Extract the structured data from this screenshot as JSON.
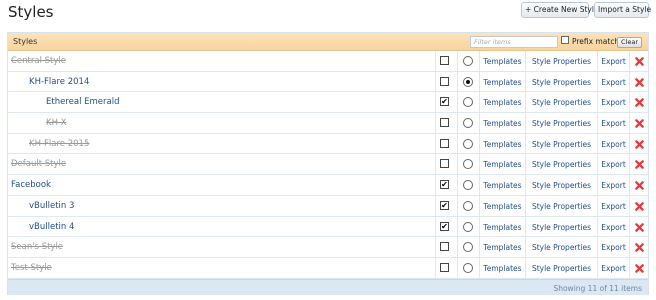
{
  "header": {
    "title": "Styles",
    "create_button": "+ Create New Style",
    "import_button": "Import a Style"
  },
  "filter": {
    "section_title": "Styles",
    "placeholder": "Filter items",
    "prefix_label": "Prefix match",
    "clear_label": "Clear"
  },
  "links": {
    "templates": "Templates",
    "properties": "Style Properties",
    "export": "Export"
  },
  "styles": [
    {
      "title": "Central Style",
      "level": 0,
      "active": false,
      "checked": false,
      "selected": false
    },
    {
      "title": "KH-Flare 2014",
      "level": 1,
      "active": true,
      "checked": false,
      "selected": true
    },
    {
      "title": "Ethereal Emerald",
      "level": 2,
      "active": true,
      "checked": true,
      "selected": false
    },
    {
      "title": "KH-X",
      "level": 2,
      "active": false,
      "checked": false,
      "selected": false
    },
    {
      "title": "KH-Flare 2015",
      "level": 1,
      "active": false,
      "checked": false,
      "selected": false
    },
    {
      "title": "Default Style",
      "level": 0,
      "active": false,
      "checked": false,
      "selected": false
    },
    {
      "title": "Facebook",
      "level": 0,
      "active": true,
      "checked": true,
      "selected": false
    },
    {
      "title": "vBulletin 3",
      "level": 1,
      "active": true,
      "checked": true,
      "selected": false
    },
    {
      "title": "vBulletin 4",
      "level": 1,
      "active": true,
      "checked": true,
      "selected": false
    },
    {
      "title": "Sean's Style",
      "level": 0,
      "active": false,
      "checked": false,
      "selected": false
    },
    {
      "title": "Test Style",
      "level": 0,
      "active": false,
      "checked": false,
      "selected": false
    }
  ],
  "footer": {
    "status": "Showing 11 of 11 items"
  },
  "colors": {
    "link": "#1f4f8a",
    "delete_icon": "#e23b3b",
    "filter_bar": "#f7d49f",
    "footer_bar": "#dbe8f3"
  }
}
